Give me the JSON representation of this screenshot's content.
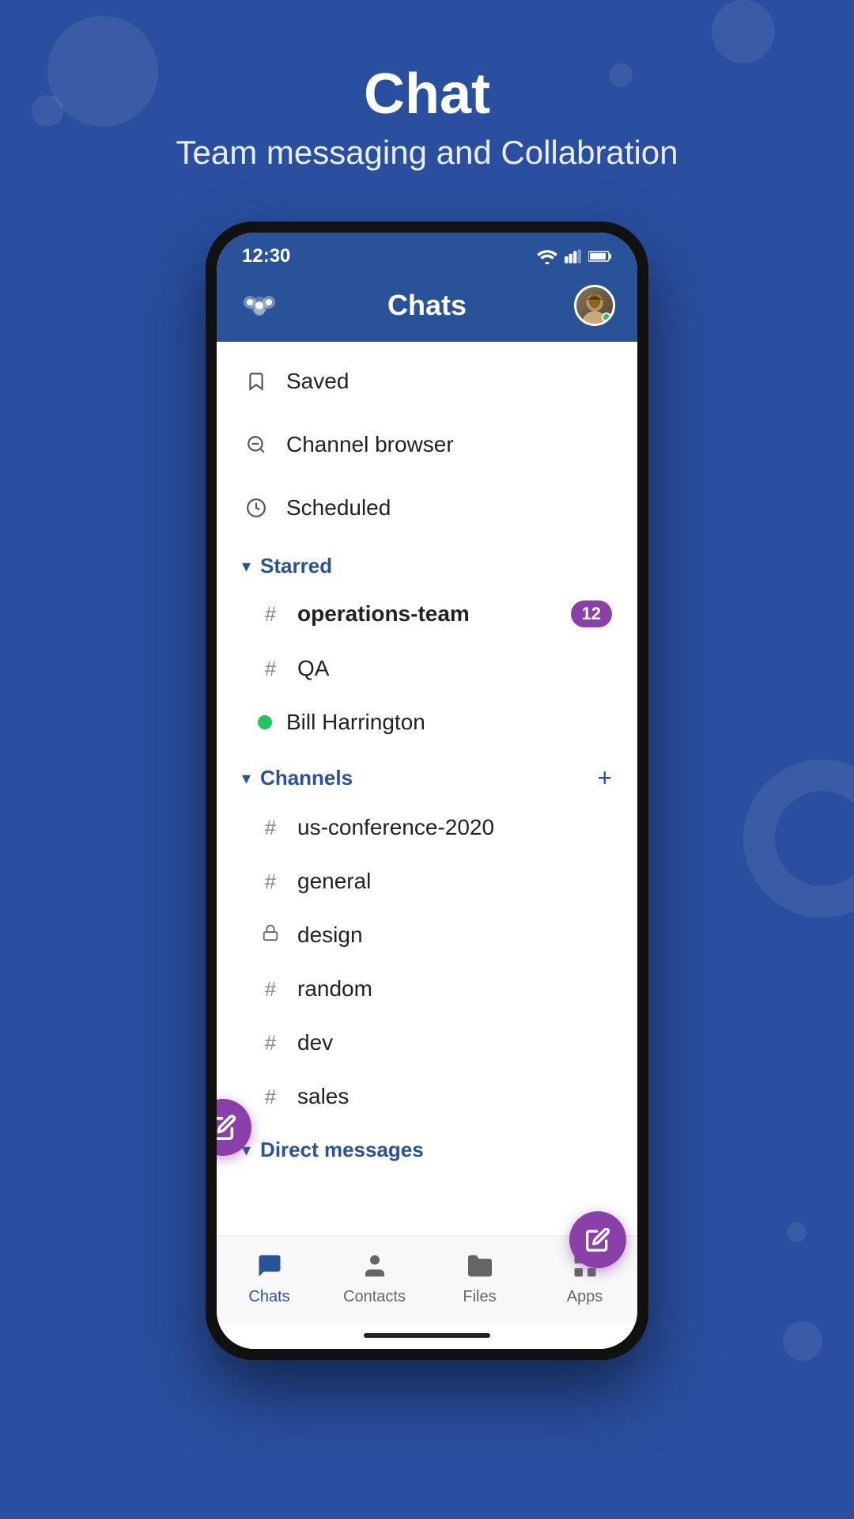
{
  "hero": {
    "title": "Chat",
    "subtitle": "Team messaging and Collabration"
  },
  "status_bar": {
    "time": "12:30"
  },
  "app_header": {
    "title": "Chats"
  },
  "quick_items": [
    {
      "label": "Saved",
      "icon": "bookmark"
    },
    {
      "label": "Channel browser",
      "icon": "channel-browser"
    },
    {
      "label": "Scheduled",
      "icon": "clock"
    }
  ],
  "starred": {
    "section_label": "Starred",
    "items": [
      {
        "name": "operations-team",
        "type": "hash",
        "badge": "12"
      },
      {
        "name": "QA",
        "type": "hash",
        "badge": null
      },
      {
        "name": "Bill Harrington",
        "type": "online",
        "badge": null
      }
    ]
  },
  "channels": {
    "section_label": "Channels",
    "add_label": "+",
    "items": [
      {
        "name": "us-conference-2020",
        "type": "hash"
      },
      {
        "name": "general",
        "type": "hash"
      },
      {
        "name": "design",
        "type": "lock"
      },
      {
        "name": "random",
        "type": "hash"
      },
      {
        "name": "dev",
        "type": "hash"
      },
      {
        "name": "sales",
        "type": "hash"
      }
    ]
  },
  "direct_messages": {
    "section_label": "Direct messages"
  },
  "bottom_nav": {
    "items": [
      {
        "label": "Chats",
        "icon": "chat",
        "active": true
      },
      {
        "label": "Contacts",
        "icon": "contacts",
        "active": false
      },
      {
        "label": "Files",
        "icon": "files",
        "active": false
      },
      {
        "label": "Apps",
        "icon": "apps",
        "active": false
      }
    ]
  }
}
